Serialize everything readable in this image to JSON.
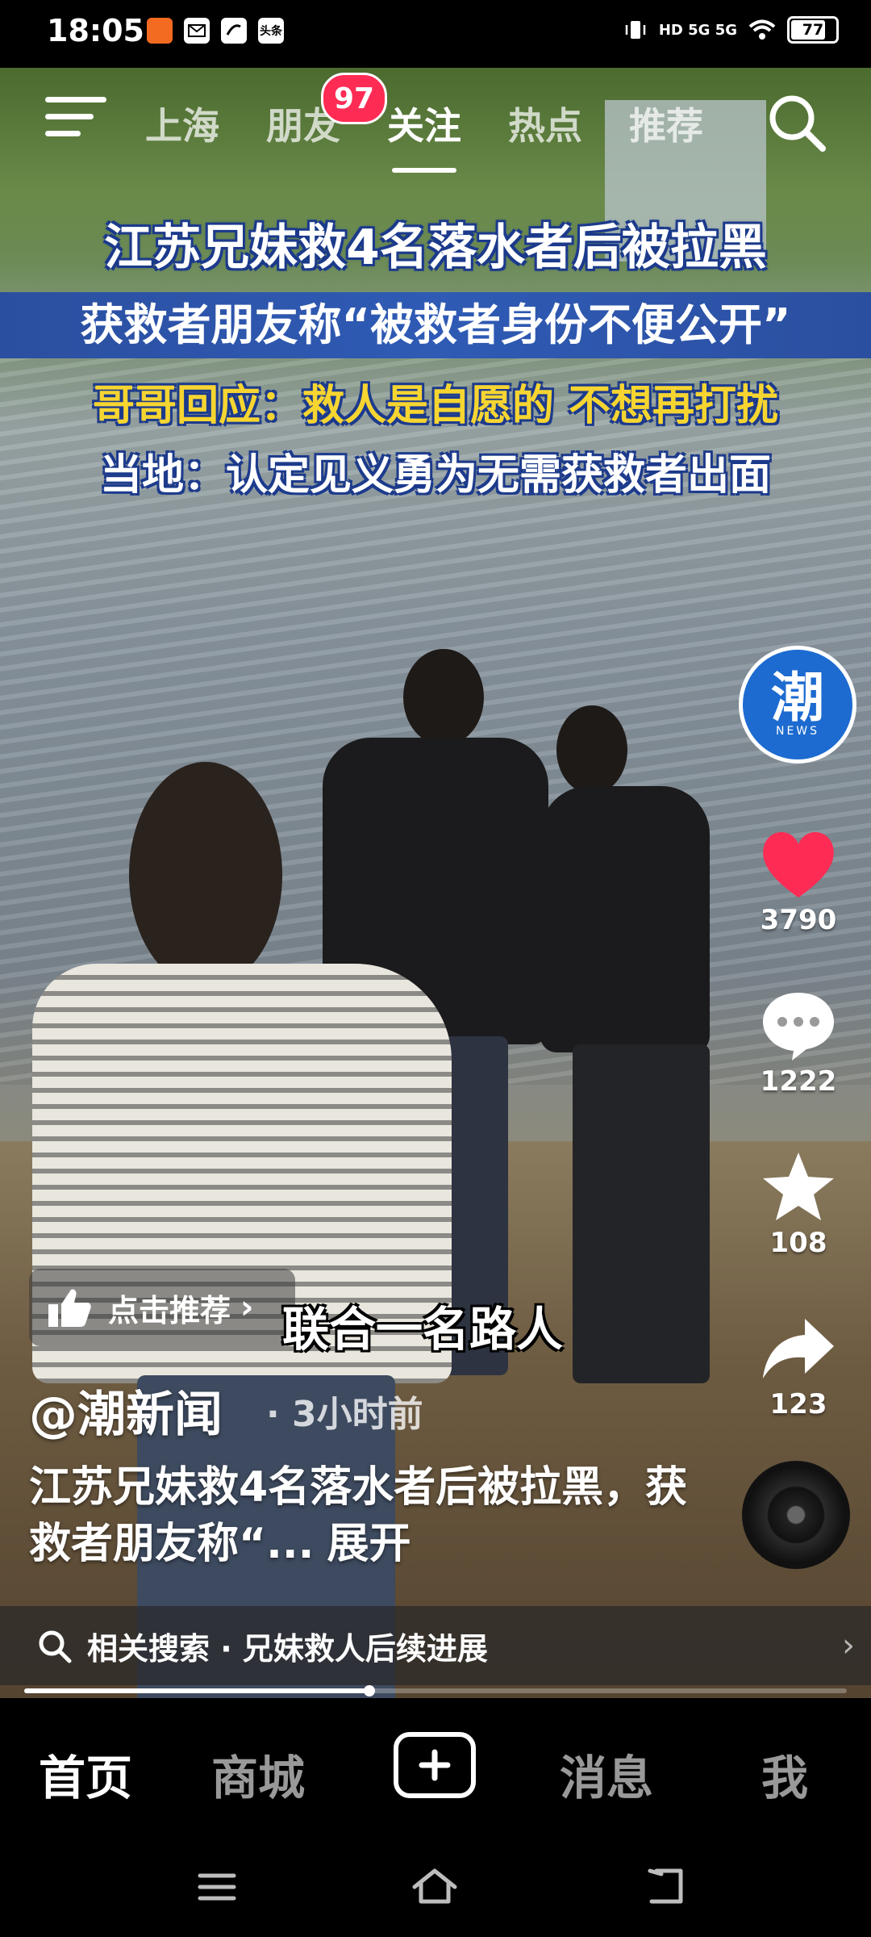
{
  "status_bar": {
    "time": "18:05",
    "app_icons": [
      "app-icon-orange",
      "app-icon-mail",
      "app-icon-link",
      "app-icon-toutiao"
    ],
    "toutiao_label": "头条",
    "network": "HD 5G 5G",
    "battery": "77"
  },
  "top_nav": {
    "tabs": [
      "上海",
      "朋友",
      "关注",
      "热点",
      "推荐"
    ],
    "active_tab": "关注",
    "friends_badge": "97"
  },
  "headlines": {
    "line1": "江苏兄妹救4名落水者后被拉黑",
    "line2": "获救者朋友称“被救者身份不便公开”",
    "line3": "哥哥回应：救人是自愿的 不想再打扰",
    "line4": "当地：认定见义勇为无需获救者出面"
  },
  "side_actions": {
    "avatar_logo": "潮",
    "avatar_sub": "NEWS",
    "likes": "3790",
    "comments": "1222",
    "favorites": "108",
    "shares": "123"
  },
  "recommend": {
    "label": "点击推荐"
  },
  "subtitle": "联合一名路人",
  "post": {
    "author": "@潮新闻",
    "time_ago": "· 3小时前",
    "description": "江苏兄妹救4名落水者后被拉黑，获救者朋友称“...",
    "expand": "展开"
  },
  "related_search": {
    "label": "相关搜索 · 兄妹救人后续进展"
  },
  "progress": {
    "fraction": 0.42
  },
  "bottom_nav": {
    "home": "首页",
    "mall": "商城",
    "messages": "消息",
    "me": "我"
  },
  "colors": {
    "accent_red": "#fe2c55",
    "headline_blue": "#2b4fa0",
    "headline_yellow": "#f7d531",
    "avatar_blue": "#1d6bd0"
  }
}
